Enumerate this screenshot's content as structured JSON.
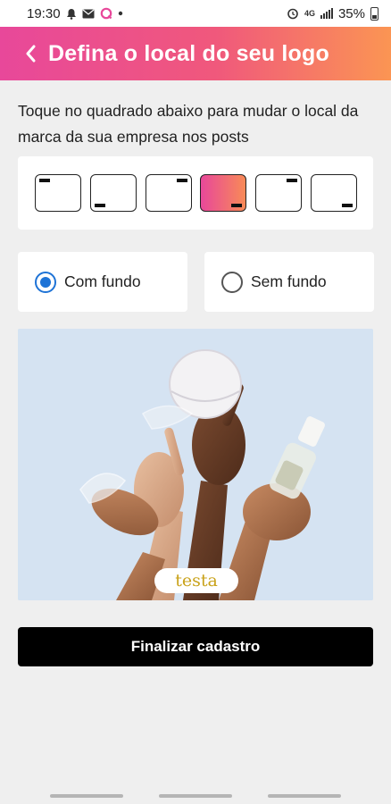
{
  "status_bar": {
    "time": "19:30",
    "network": "4G",
    "battery_text": "35%",
    "icons": [
      "notification-bell-icon",
      "mail-icon",
      "app-icon",
      "dot-icon",
      "alarm-icon",
      "signal-icon",
      "battery-icon"
    ]
  },
  "header": {
    "title": "Defina o local do seu logo",
    "back_icon": "chevron-left-icon",
    "gradient": [
      "#e8489a",
      "#fb9553"
    ]
  },
  "instructions": "Toque no quadrado abaixo para mudar o local da marca da sua empresa nos posts",
  "positions": {
    "options": [
      "top-left",
      "bottom-left",
      "top-right",
      "bottom-right",
      "top-right",
      "bottom-right"
    ],
    "selected_index": 3
  },
  "background_options": {
    "with": "Com fundo",
    "without": "Sem fundo",
    "selected": "with"
  },
  "preview": {
    "logo_text": "testa"
  },
  "finish_button": "Finalizar cadastro",
  "colors": {
    "accent_blue": "#1e73d6",
    "logo_gold": "#c9a21a"
  }
}
